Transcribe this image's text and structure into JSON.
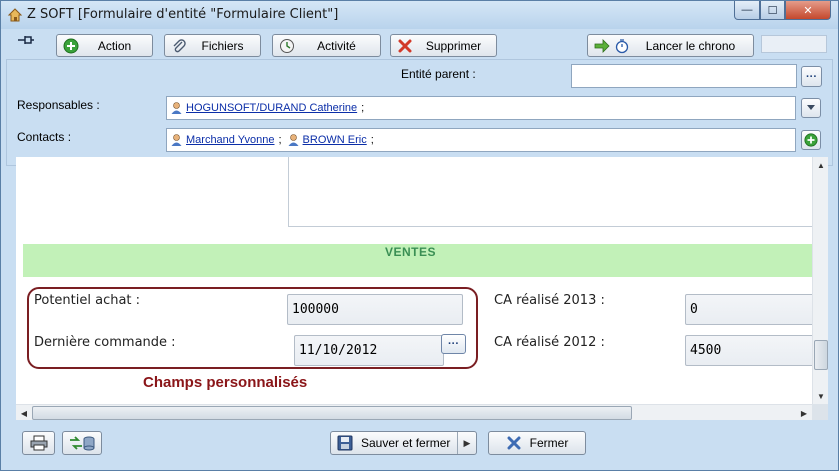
{
  "window": {
    "title": "Z SOFT [Formulaire d'entité \"Formulaire Client\"]",
    "min_symbol": "—",
    "max_symbol": "☐",
    "close_symbol": "✕"
  },
  "toolbar": {
    "action": "Action",
    "fichiers": "Fichiers",
    "activite": "Activité",
    "supprimer": "Supprimer",
    "lancer_chrono": "Lancer le chrono"
  },
  "header": {
    "entite_parent_label": "Entité parent :",
    "entite_parent_value": "",
    "responsables_label": "Responsables :",
    "responsables": [
      {
        "name": "HOGUNSOFT/DURAND Catherine",
        "sep": ";"
      }
    ],
    "contacts_label": "Contacts :",
    "contacts": [
      {
        "name": "Marchand Yvonne",
        "sep": ";"
      },
      {
        "name": "BROWN Eric",
        "sep": ";"
      }
    ],
    "dots_label": "···"
  },
  "ventes": {
    "section_title": "VENTES",
    "potentiel_label": "Potentiel achat :",
    "potentiel_value": "100000",
    "derniere_label": "Dernière commande :",
    "derniere_value": "11/10/2012",
    "ca2013_label": "CA réalisé 2013 :",
    "ca2013_value": "0",
    "ca2012_label": "CA réalisé 2012 :",
    "ca2012_value": "4500",
    "champs_label": "Champs personnalisés"
  },
  "scroll": {
    "up": "▲",
    "down": "▼",
    "left": "◀",
    "right": "▶"
  },
  "bottom": {
    "sauver_fermer": "Sauver et fermer",
    "split_arrow": "▶",
    "fermer": "Fermer"
  },
  "colors": {
    "accent_band": "#c2f1b8",
    "band_text": "#3a8f54",
    "group_border": "#7a1e22",
    "link": "#0b2ea8"
  }
}
